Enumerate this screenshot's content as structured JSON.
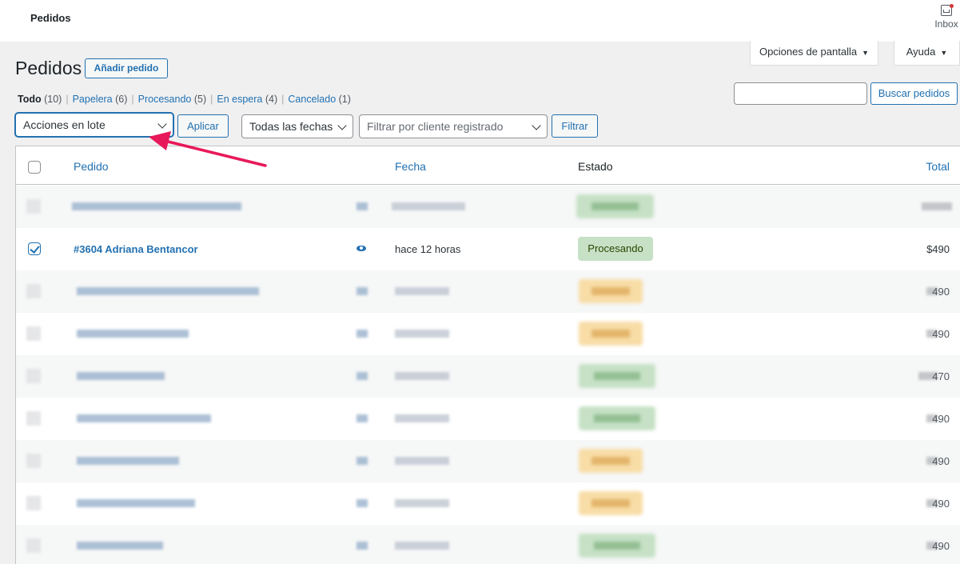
{
  "header": {
    "title": "Pedidos",
    "inbox_label": "Inbox"
  },
  "screen_tabs": {
    "screen_options": "Opciones de pantalla",
    "help": "Ayuda"
  },
  "page": {
    "title": "Pedidos",
    "add_order": "Añadir pedido"
  },
  "status_filters": [
    {
      "label": "Todo",
      "count": "(10)"
    },
    {
      "label": "Papelera",
      "count": "(6)"
    },
    {
      "label": "Procesando",
      "count": "(5)"
    },
    {
      "label": "En espera",
      "count": "(4)"
    },
    {
      "label": "Cancelado",
      "count": "(1)"
    }
  ],
  "search": {
    "value": "",
    "button": "Buscar pedidos"
  },
  "toolbar": {
    "bulk_actions": "Acciones en lote",
    "apply": "Aplicar",
    "all_dates": "Todas las fechas",
    "customer_placeholder": "Filtrar por cliente registrado",
    "filter": "Filtrar"
  },
  "table": {
    "columns": {
      "order": "Pedido",
      "date": "Fecha",
      "status": "Estado",
      "total": "Total"
    },
    "visible_order": {
      "order": "#3604 Adriana Bentancor",
      "date": "hace 12 horas",
      "status": "Procesando",
      "total": "$490"
    },
    "blurred_total_suffixes": [
      "490",
      "490",
      "470",
      "490",
      "490",
      "490",
      "490"
    ]
  },
  "colors": {
    "accent": "#2271b1",
    "processing_bg": "#c6e1c6",
    "on_hold_bg": "#f8dda7",
    "annotation_arrow": "#e8195a"
  }
}
